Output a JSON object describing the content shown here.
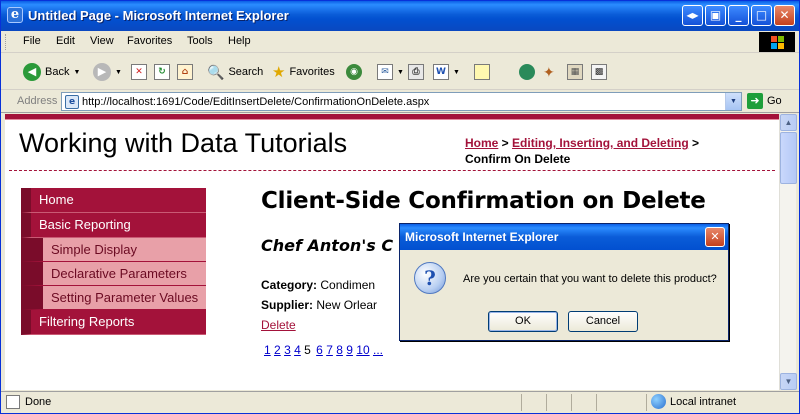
{
  "window": {
    "title": "Untitled Page - Microsoft Internet Explorer"
  },
  "menu": [
    "File",
    "Edit",
    "View",
    "Favorites",
    "Tools",
    "Help"
  ],
  "toolbar": {
    "back": "Back",
    "search": "Search",
    "favorites": "Favorites"
  },
  "address": {
    "label": "Address",
    "url": "http://localhost:1691/Code/EditInsertDelete/ConfirmationOnDelete.aspx",
    "go": "Go"
  },
  "page": {
    "site_title": "Working with Data Tutorials",
    "breadcrumb": {
      "home": "Home",
      "sep1": " > ",
      "section": "Editing, Inserting, and Deleting",
      "sep2": " >",
      "current": "Confirm On Delete"
    },
    "nav": {
      "home": "Home",
      "basic_reporting": "Basic Reporting",
      "simple_display": "Simple Display",
      "declarative_parameters": "Declarative Parameters",
      "setting_parameter_values": "Setting Parameter Values",
      "filtering_reports": "Filtering Reports"
    },
    "heading": "Client-Side Confirmation on Delete",
    "product_name": "Chef Anton's C",
    "category_label": "Category:",
    "category_value": "Condimen",
    "supplier_label": "Supplier:",
    "supplier_value": "New Orlear",
    "delete_link": "Delete",
    "pager": {
      "pages": [
        "1",
        "2",
        "3",
        "4",
        "5",
        "6",
        "7",
        "8",
        "9",
        "10"
      ],
      "current": "5",
      "more": "..."
    }
  },
  "status": {
    "text": "Done",
    "zone": "Local intranet"
  },
  "dialog": {
    "title": "Microsoft Internet Explorer",
    "message": "Are you certain that you want to delete this product?",
    "ok": "OK",
    "cancel": "Cancel"
  }
}
